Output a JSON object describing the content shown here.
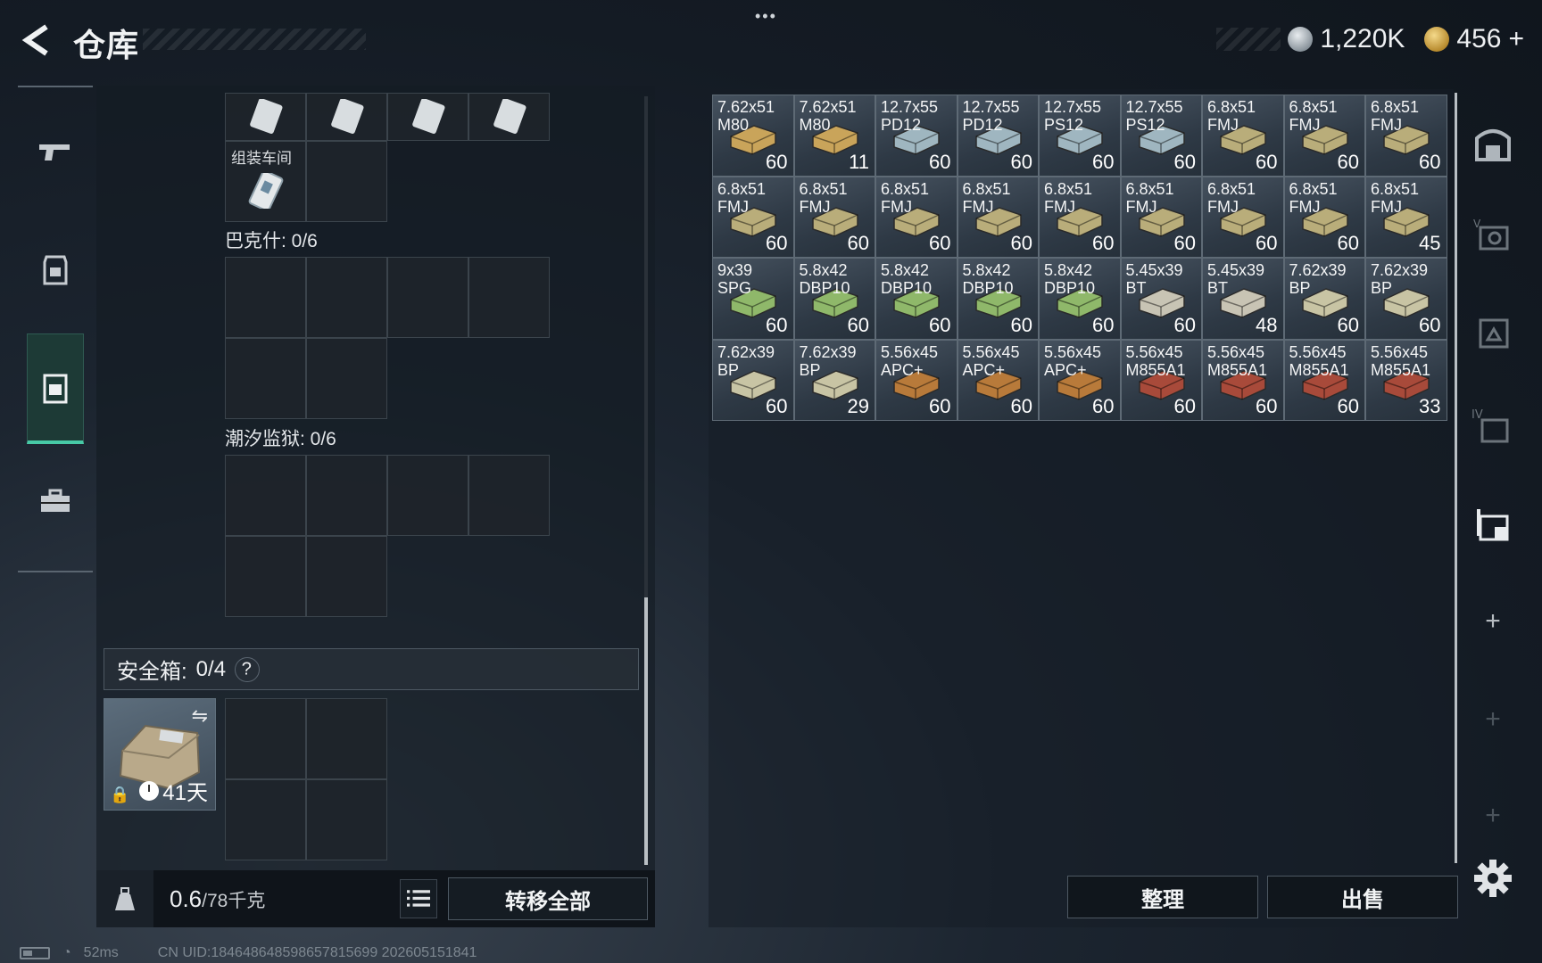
{
  "header": {
    "title": "仓库",
    "more": "•••",
    "currency_silver": "1,220K",
    "currency_gold": "456",
    "currency_gold_add": "+"
  },
  "left_panel": {
    "workshop_label": "组装车间",
    "section_bakesh": "巴克什: 0/6",
    "section_tidal": "潮汐监狱: 0/6",
    "safebox_label": "安全箱:",
    "safebox_count": "0/4",
    "safebox_help": "?",
    "safebox_swap": "⇋",
    "safebox_timer": "41天",
    "weight_value": "0.6",
    "weight_limit": "/78千克",
    "transfer_all": "转移全部"
  },
  "ammo": [
    {
      "cal": "7.62x51\nM80",
      "count": "60",
      "color": "#c9a45a"
    },
    {
      "cal": "7.62x51\nM80",
      "count": "11",
      "color": "#c9a45a"
    },
    {
      "cal": "12.7x55\nPD12",
      "count": "60",
      "color": "#9fb6c0"
    },
    {
      "cal": "12.7x55\nPD12",
      "count": "60",
      "color": "#9fb6c0"
    },
    {
      "cal": "12.7x55\nPS12",
      "count": "60",
      "color": "#9fb6c0"
    },
    {
      "cal": "12.7x55\nPS12",
      "count": "60",
      "color": "#9fb6c0"
    },
    {
      "cal": "6.8x51\nFMJ",
      "count": "60",
      "color": "#b9ad7a"
    },
    {
      "cal": "6.8x51\nFMJ",
      "count": "60",
      "color": "#b9ad7a"
    },
    {
      "cal": "6.8x51\nFMJ",
      "count": "60",
      "color": "#b9ad7a"
    },
    {
      "cal": "6.8x51\nFMJ",
      "count": "60",
      "color": "#b9ad7a"
    },
    {
      "cal": "6.8x51\nFMJ",
      "count": "60",
      "color": "#b9ad7a"
    },
    {
      "cal": "6.8x51\nFMJ",
      "count": "60",
      "color": "#b9ad7a"
    },
    {
      "cal": "6.8x51\nFMJ",
      "count": "60",
      "color": "#b9ad7a"
    },
    {
      "cal": "6.8x51\nFMJ",
      "count": "60",
      "color": "#b9ad7a"
    },
    {
      "cal": "6.8x51\nFMJ",
      "count": "60",
      "color": "#b9ad7a"
    },
    {
      "cal": "6.8x51\nFMJ",
      "count": "60",
      "color": "#b9ad7a"
    },
    {
      "cal": "6.8x51\nFMJ",
      "count": "60",
      "color": "#b9ad7a"
    },
    {
      "cal": "6.8x51\nFMJ",
      "count": "45",
      "color": "#b9ad7a"
    },
    {
      "cal": "9x39\nSPG",
      "count": "60",
      "color": "#8fb86a"
    },
    {
      "cal": "5.8x42\nDBP10",
      "count": "60",
      "color": "#8fb86a"
    },
    {
      "cal": "5.8x42\nDBP10",
      "count": "60",
      "color": "#8fb86a"
    },
    {
      "cal": "5.8x42\nDBP10",
      "count": "60",
      "color": "#8fb86a"
    },
    {
      "cal": "5.8x42\nDBP10",
      "count": "60",
      "color": "#8fb86a"
    },
    {
      "cal": "5.45x39\nBT",
      "count": "60",
      "color": "#c8c4b4"
    },
    {
      "cal": "5.45x39\nBT",
      "count": "48",
      "color": "#c8c4b4"
    },
    {
      "cal": "7.62x39\nBP",
      "count": "60",
      "color": "#c8c4a4"
    },
    {
      "cal": "7.62x39\nBP",
      "count": "60",
      "color": "#c8c4a4"
    },
    {
      "cal": "7.62x39\nBP",
      "count": "60",
      "color": "#c8c4a4"
    },
    {
      "cal": "7.62x39\nBP",
      "count": "29",
      "color": "#c8c4a4"
    },
    {
      "cal": "5.56x45\nAPC+",
      "count": "60",
      "color": "#b87a3a"
    },
    {
      "cal": "5.56x45\nAPC+",
      "count": "60",
      "color": "#b87a3a"
    },
    {
      "cal": "5.56x45\nAPC+",
      "count": "60",
      "color": "#b87a3a"
    },
    {
      "cal": "5.56x45\nM855A1",
      "count": "60",
      "color": "#a84a3a"
    },
    {
      "cal": "5.56x45\nM855A1",
      "count": "60",
      "color": "#a84a3a"
    },
    {
      "cal": "5.56x45\nM855A1",
      "count": "60",
      "color": "#a84a3a"
    },
    {
      "cal": "5.56x45\nM855A1",
      "count": "33",
      "color": "#a84a3a"
    }
  ],
  "buttons": {
    "sort": "整理",
    "sell": "出售"
  },
  "status": {
    "ping": "52ms",
    "uid": "CN UID:1846486485986578156​99 202605151841"
  }
}
